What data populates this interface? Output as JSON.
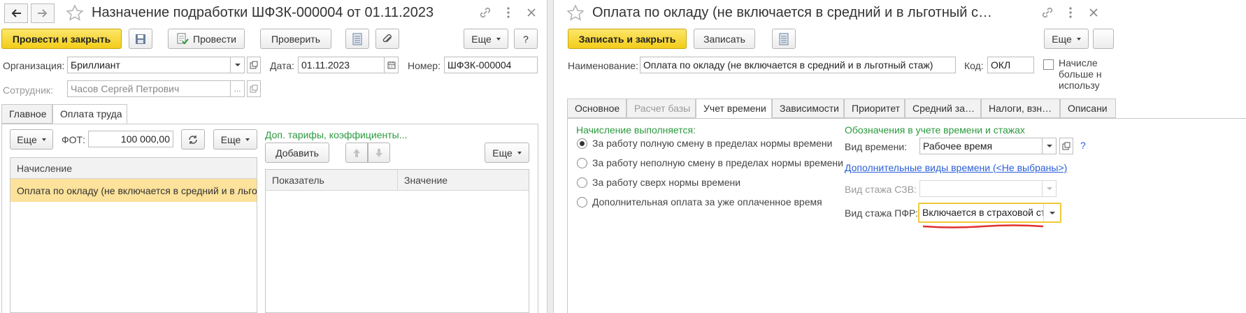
{
  "left": {
    "title": "Назначение подработки ШФЗК-000004 от 01.11.2023",
    "toolbar": {
      "post_close": "Провести и закрыть",
      "post": "Провести",
      "check": "Проверить",
      "more": "Еще",
      "help": "?"
    },
    "org_label": "Организация:",
    "org_value": "Бриллиант",
    "date_label": "Дата:",
    "date_value": "01.11.2023",
    "num_label": "Номер:",
    "num_value": "ШФЗК-000004",
    "emp_label": "Сотрудник:",
    "emp_value": "Часов Сергей Петрович",
    "emp_ellipsis": "...",
    "tabs": [
      "Главное",
      "Оплата труда"
    ],
    "fot_more": "Еще",
    "fot_label": "ФОТ:",
    "fot_value": "100 000,00",
    "more2": "Еще",
    "extra_link": "Доп. тарифы, коэффициенты...",
    "add": "Добавить",
    "more3": "Еще",
    "accrual_header": "Начисление",
    "accrual_row": "Оплата по окладу (не включается в средний и в льготный стаж)",
    "ind_header": "Показатель",
    "val_header": "Значение"
  },
  "right": {
    "title": "Оплата по окладу (не включается в средний и в льготный с…",
    "toolbar": {
      "save_close": "Записать и закрыть",
      "save": "Записать",
      "more": "Еще"
    },
    "name_label": "Наименование:",
    "name_value": "Оплата по окладу (не включается в средний и в льготный стаж)",
    "code_label": "Код:",
    "code_value": "ОКЛ",
    "check_text": [
      "Начисле",
      "больше н",
      "использу"
    ],
    "tabs": [
      "Основное",
      "Расчет базы",
      "Учет времени",
      "Зависимости",
      "Приоритет",
      "Средний за…",
      "Налоги, взн…",
      "Описани"
    ],
    "accrual_title": "Начисление выполняется:",
    "radios": [
      "За работу полную смену в пределах нормы времени",
      "За работу неполную смену в пределах нормы времени",
      "За работу сверх нормы времени",
      "Дополнительная оплата за уже оплаченное время"
    ],
    "notation_title": "Обозначения в учете времени и стажах",
    "time_kind_label": "Вид времени:",
    "time_kind_value": "Рабочее время",
    "help": "?",
    "extra_time_link": "Дополнительные виды времени (<Не выбраны>)",
    "szv_label": "Вид стажа СЗВ:",
    "szv_value": "",
    "pfr_label": "Вид стажа ПФР:",
    "pfr_value": "Включается в страховой стаж"
  },
  "colors": {
    "accent_yellow": "#f5d21c",
    "link_green": "#2b9a3e",
    "link_blue": "#2a5ed8",
    "selected_row": "#fce29a",
    "error_underline": "#e03030"
  }
}
